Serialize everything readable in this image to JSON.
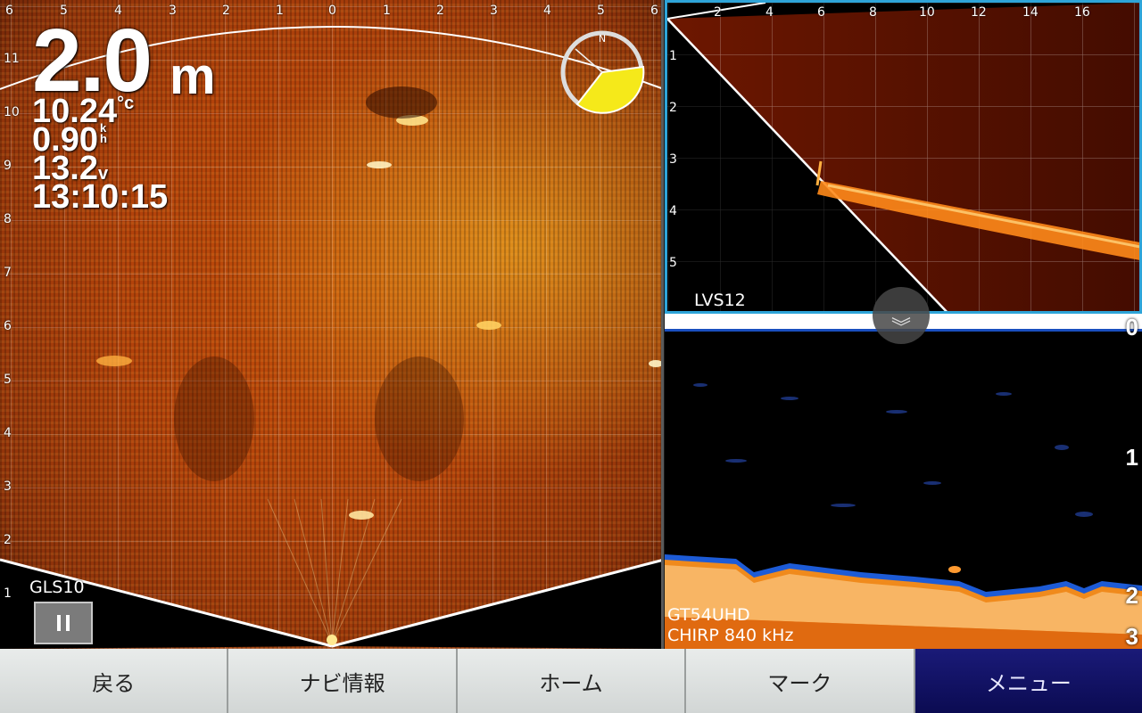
{
  "left_panel": {
    "label": "GLS10",
    "depth": {
      "value": "2.0",
      "unit": "m"
    },
    "water_temp": {
      "value": "10.24",
      "unit": "°c"
    },
    "speed": {
      "value": "0.90",
      "unit_top": "k",
      "unit_bottom": "h"
    },
    "voltage": {
      "value": "13.2",
      "unit": "v"
    },
    "time": "13:10:15",
    "top_scale": [
      "6",
      "5",
      "4",
      "3",
      "2",
      "1",
      "0",
      "1",
      "2",
      "3",
      "4",
      "5",
      "6"
    ],
    "left_scale": [
      "11",
      "10",
      "9",
      "8",
      "7",
      "6",
      "5",
      "4",
      "3",
      "2",
      "1"
    ],
    "compass_label": "N",
    "colors": {
      "sector": "#f5e91a"
    }
  },
  "lvs_panel": {
    "label": "LVS12",
    "top_scale": [
      "2",
      "4",
      "6",
      "8",
      "10",
      "12",
      "14",
      "16"
    ],
    "left_scale": [
      "1",
      "2",
      "3",
      "4",
      "5"
    ],
    "colors": {
      "frame": "#2ea4d8"
    }
  },
  "gt_panel": {
    "model": "GT54UHD",
    "frequency": "CHIRP 840 kHz",
    "depth_scale": [
      "0",
      "1",
      "2",
      "3"
    ]
  },
  "collapse_icon": "double-chevron-down-icon",
  "nav": {
    "back": "戻る",
    "navi_info": "ナビ情報",
    "home": "ホーム",
    "mark": "マーク",
    "menu": "メニュー"
  }
}
